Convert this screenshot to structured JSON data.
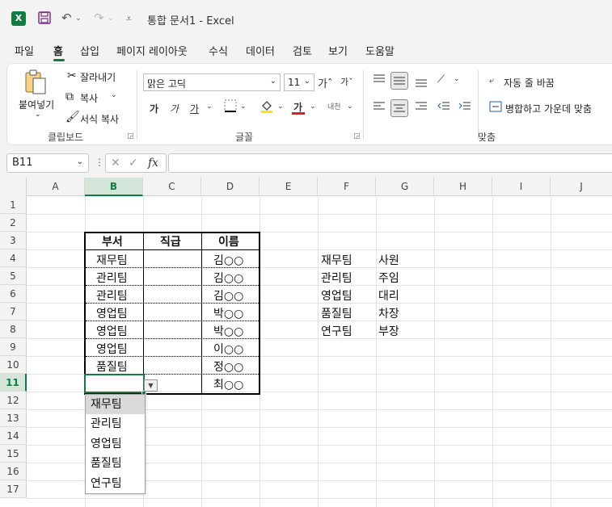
{
  "titlebar": {
    "app_logo": "X",
    "title": "통합 문서1  -  Excel",
    "qa_icons": [
      "save-icon",
      "undo-icon",
      "redo-icon",
      "customize-icon"
    ]
  },
  "tabs": [
    {
      "label": "파일"
    },
    {
      "label": "홈"
    },
    {
      "label": "삽입"
    },
    {
      "label": "페이지 레이아웃"
    },
    {
      "label": "수식"
    },
    {
      "label": "데이터"
    },
    {
      "label": "검토"
    },
    {
      "label": "보기"
    },
    {
      "label": "도움말"
    }
  ],
  "ribbon": {
    "clipboard": {
      "paste": "붙여넣기",
      "cut": "잘라내기",
      "copy": "복사",
      "format_painter": "서식 복사",
      "group": "클립보드"
    },
    "font": {
      "font_name": "맑은 고딕",
      "font_size": "11",
      "increase": "가ˆ",
      "decrease": "가ˇ",
      "bold": "가",
      "italic": "가",
      "underline": "가",
      "font_color": "가",
      "phonetic": "내천",
      "group": "글꼴"
    },
    "alignment": {
      "wrap_text": "자동 줄 바꿈",
      "merge_center": "병합하고 가운데 맞춤",
      "group": "맞춤"
    }
  },
  "formula_bar": {
    "name_box": "B11",
    "fx": "fx",
    "value": ""
  },
  "grid": {
    "columns": [
      "A",
      "B",
      "C",
      "D",
      "E",
      "F",
      "G",
      "H",
      "I",
      "J"
    ],
    "rows": [
      "1",
      "2",
      "3",
      "4",
      "5",
      "6",
      "7",
      "8",
      "9",
      "10",
      "11",
      "12",
      "13",
      "14",
      "15",
      "16",
      "17"
    ],
    "selected_column": "B",
    "selected_row": "11"
  },
  "table": {
    "headers": [
      "부서",
      "직급",
      "이름"
    ],
    "rows": [
      {
        "dept": "재무팀",
        "rank": "",
        "name": "김○○"
      },
      {
        "dept": "관리팀",
        "rank": "",
        "name": "김○○"
      },
      {
        "dept": "관리팀",
        "rank": "",
        "name": "김○○"
      },
      {
        "dept": "영업팀",
        "rank": "",
        "name": "박○○"
      },
      {
        "dept": "영업팀",
        "rank": "",
        "name": "박○○"
      },
      {
        "dept": "영업팀",
        "rank": "",
        "name": "이○○"
      },
      {
        "dept": "품질팀",
        "rank": "",
        "name": "정○○"
      },
      {
        "dept": "",
        "rank": "",
        "name": "최○○"
      }
    ]
  },
  "lookup": {
    "depts": [
      "재무팀",
      "관리팀",
      "영업팀",
      "품질팀",
      "연구팀"
    ],
    "ranks": [
      "사원",
      "주임",
      "대리",
      "차장",
      "부장"
    ]
  },
  "dropdown_list": {
    "items": [
      "재무팀",
      "관리팀",
      "영업팀",
      "품질팀",
      "연구팀"
    ],
    "highlighted": "재무팀"
  },
  "colors": {
    "excel_green": "#107c41",
    "selected_header_bg": "#d3e6d9"
  }
}
